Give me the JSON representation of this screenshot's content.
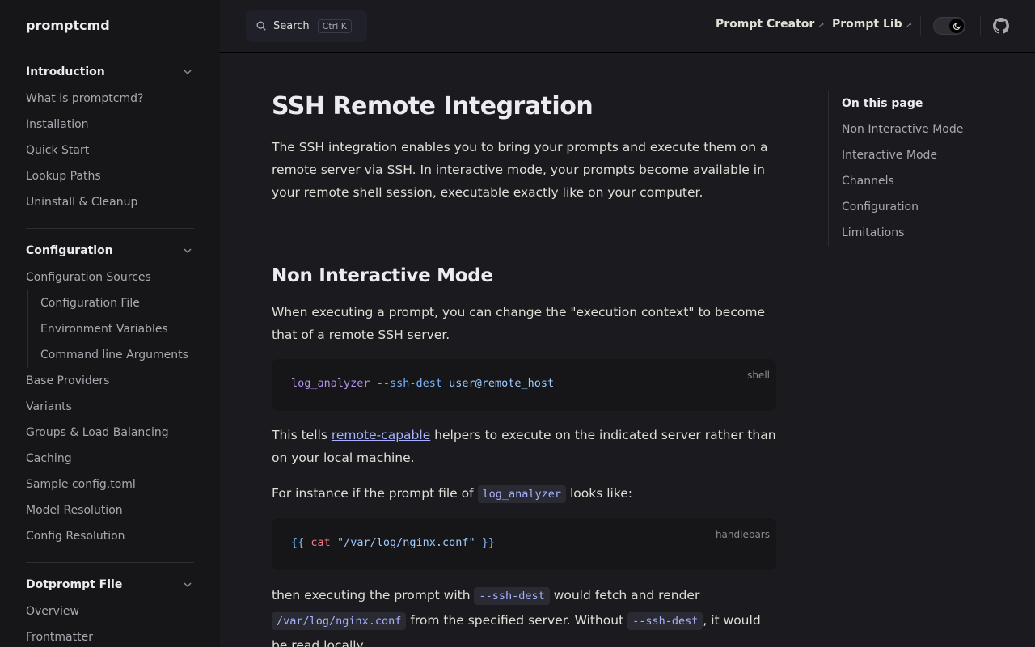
{
  "brand": "promptcmd",
  "search": {
    "label": "Search",
    "shortcut": "Ctrl K"
  },
  "topnav": {
    "links": [
      "Prompt Creator",
      "Prompt Lib"
    ]
  },
  "sidebar": {
    "groups": [
      {
        "title": "Introduction",
        "items": [
          {
            "label": "What is promptcmd?"
          },
          {
            "label": "Installation"
          },
          {
            "label": "Quick Start"
          },
          {
            "label": "Lookup Paths"
          },
          {
            "label": "Uninstall & Cleanup"
          }
        ]
      },
      {
        "title": "Configuration",
        "items": [
          {
            "label": "Configuration Sources"
          },
          {
            "label": "Configuration File",
            "sub": true
          },
          {
            "label": "Environment Variables",
            "sub": true
          },
          {
            "label": "Command line Arguments",
            "sub": true
          },
          {
            "label": "Base Providers"
          },
          {
            "label": "Variants"
          },
          {
            "label": "Groups & Load Balancing"
          },
          {
            "label": "Caching"
          },
          {
            "label": "Sample config.toml"
          },
          {
            "label": "Model Resolution"
          },
          {
            "label": "Config Resolution"
          }
        ]
      },
      {
        "title": "Dotprompt File",
        "items": [
          {
            "label": "Overview"
          },
          {
            "label": "Frontmatter"
          }
        ]
      }
    ]
  },
  "main": {
    "title": "SSH Remote Integration",
    "intro": "The SSH integration enables you to bring your prompts and execute them on a remote server via SSH. In interactive mode, your prompts become available in your remote shell session, executable exactly like on your computer.",
    "section_title": "Non Interactive Mode",
    "p1": "When executing a prompt, you can change the \"execution context\" to become that of a remote SSH server.",
    "code1": {
      "lang": "shell",
      "cmd": "log_analyzer",
      "flag": "--ssh-dest",
      "arg": "user@remote_host"
    },
    "p2": {
      "before": "This tells ",
      "link": "remote-capable",
      "after": " helpers to execute on the indicated server rather than on your local machine."
    },
    "p3": {
      "before": "For instance if the prompt file of ",
      "code": "log_analyzer",
      "after": " looks like:"
    },
    "code2": {
      "lang": "handlebars",
      "open": "{{",
      "kw": "cat",
      "str": "\"/var/log/nginx.conf\"",
      "close": "}}"
    },
    "p4": {
      "t1": "then executing the prompt with ",
      "c1": "--ssh-dest",
      "t2": " would fetch and render ",
      "c2": "/var/log/nginx.conf",
      "t3": " from the specified server. Without ",
      "c3": "--ssh-dest",
      "t4": ", it would be read locally."
    }
  },
  "toc": {
    "title": "On this page",
    "items": [
      "Non Interactive Mode",
      "Interactive Mode",
      "Channels",
      "Configuration",
      "Limitations"
    ]
  }
}
